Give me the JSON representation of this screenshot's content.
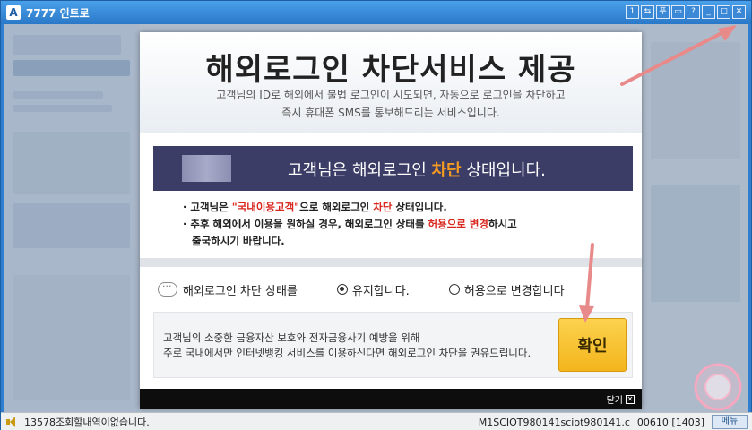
{
  "window": {
    "app_icon": "A",
    "title": "7777 인트로",
    "buttons": [
      "1",
      "⇆",
      "푸",
      "▭",
      "?",
      "_",
      "□",
      "✕"
    ]
  },
  "popup": {
    "title": "해외로그인 차단서비스 제공",
    "subtitle_line1": "고객님의 ID로 해외에서 불법 로그인이 시도되면, 자동으로 로그인을 차단하고",
    "subtitle_line2": "즉시 휴대폰 SMS를 통보해드리는 서비스입니다.",
    "status_prefix": "고객님은 해외로그인 ",
    "status_highlight": "차단",
    "status_suffix": " 상태입니다.",
    "note1_a": "· 고객님은 ",
    "note1_red": "\"국내이용고객\"",
    "note1_b": "으로 해외로그인 ",
    "note1_red2": "차단",
    "note1_c": " 상태입니다.",
    "note2_a": "· 추후 해외에서 이용을 원하실 경우, 해외로그인 상태를 ",
    "note2_red": "허용으로 변경",
    "note2_b": "하시고",
    "note2_c": "출국하시기 바랍니다.",
    "choice_label": "해외로그인 차단 상태를",
    "option_keep": "유지합니다.",
    "option_allow": "허용으로 변경합니다",
    "info_line1": "고객님의 소중한 금융자산 보호와 전자금융사기 예방을 위해",
    "info_line2": "주로 국내에서만 인터넷뱅킹 서비스를 이용하신다면 해외로그인 차단을 권유드립니다.",
    "confirm_label": "확인",
    "close_label": "닫기"
  },
  "statusbar": {
    "message": "13578조회할내역이없습니다.",
    "session": "M1SCIOT980141sciot980141.c",
    "code": "00610 [1403]",
    "menu_label": "메뉴"
  },
  "colors": {
    "accent_orange": "#f29a21",
    "notice_red": "#d9261c",
    "confirm_yellow": "#f3b51c",
    "status_navy": "#3c3d67",
    "title_blue": "#2a78c8"
  }
}
